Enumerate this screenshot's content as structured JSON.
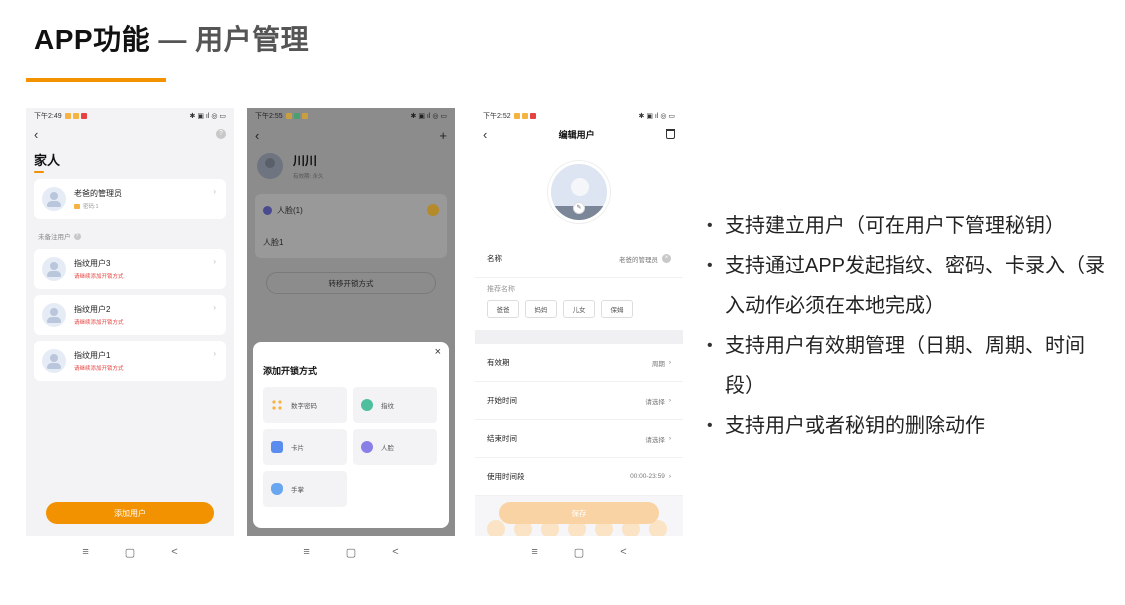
{
  "title": {
    "main": "APP功能",
    "sep": " — ",
    "sub": "用户管理"
  },
  "phone1": {
    "time": "下午2:49",
    "heading": "家人",
    "admin": {
      "name": "老爸的管理员",
      "sub": "密码:1"
    },
    "section_label": "未备注用户",
    "users": [
      {
        "name": "指纹用户3",
        "sub": "请继续添加开锁方式"
      },
      {
        "name": "指纹用户2",
        "sub": "请继续添加开锁方式"
      },
      {
        "name": "指纹用户1",
        "sub": "请继续添加开锁方式"
      }
    ],
    "add_button": "添加用户"
  },
  "phone2": {
    "time": "下午2:55",
    "user_name": "川川",
    "user_perm": "有效期: 永久",
    "face_group": "人脸(1)",
    "face_item": "人脸1",
    "transfer_button": "转移开锁方式",
    "sheet_title": "添加开锁方式",
    "options": [
      "数字密码",
      "指纹",
      "卡片",
      "人脸",
      "手掌"
    ]
  },
  "phone3": {
    "time": "下午2:52",
    "title": "编辑用户",
    "name_label": "名称",
    "name_value": "老爸的管理员",
    "suggest_label": "推荐名称",
    "chips": [
      "爸爸",
      "妈妈",
      "儿女",
      "保姆"
    ],
    "fields": [
      {
        "label": "有效期",
        "value": "周期"
      },
      {
        "label": "开始时间",
        "value": "请选择"
      },
      {
        "label": "结束时间",
        "value": "请选择"
      },
      {
        "label": "使用时间段",
        "value": "00:00-23:59"
      }
    ],
    "save_button": "保存"
  },
  "nav": {
    "menu": "≡",
    "home": "▢",
    "back": "<"
  },
  "bullets": [
    "支持建立用户（可在用户下管理秘钥）",
    "支持通过APP发起指纹、密码、卡录入（录入动作必须在本地完成）",
    "支持用户有效期管理（日期、周期、时间段）",
    "支持用户或者秘钥的删除动作"
  ],
  "colors": {
    "accent": "#f39200",
    "error": "#e64340"
  }
}
